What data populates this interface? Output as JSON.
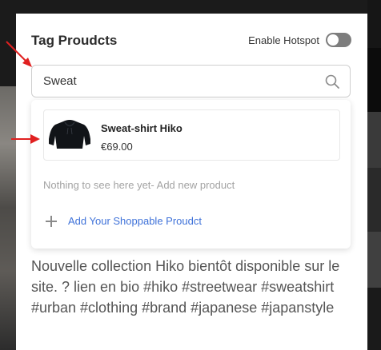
{
  "panel": {
    "title": "Tag Proudcts",
    "hotspot_label": "Enable Hotspot",
    "hotspot_enabled": false
  },
  "search": {
    "value": "Sweat",
    "icon": "search-icon"
  },
  "results": [
    {
      "name": "Sweat-shirt Hiko",
      "price": "€69.00",
      "thumb": "black-hoodie"
    }
  ],
  "dropdown": {
    "empty_message": "Nothing to see here yet- Add new product",
    "add_label": "Add Your Shoppable Proudct"
  },
  "caption": "Nouvelle collection Hiko bientôt disponible sur le site. ? lien en bio #hiko #streetwear #sweatshirt #urban #clothing #brand #japanese #japanstyle",
  "colors": {
    "accent_link": "#3f72d9",
    "annotation_arrow": "#e02020",
    "toggle_off": "#7d7d7d"
  }
}
